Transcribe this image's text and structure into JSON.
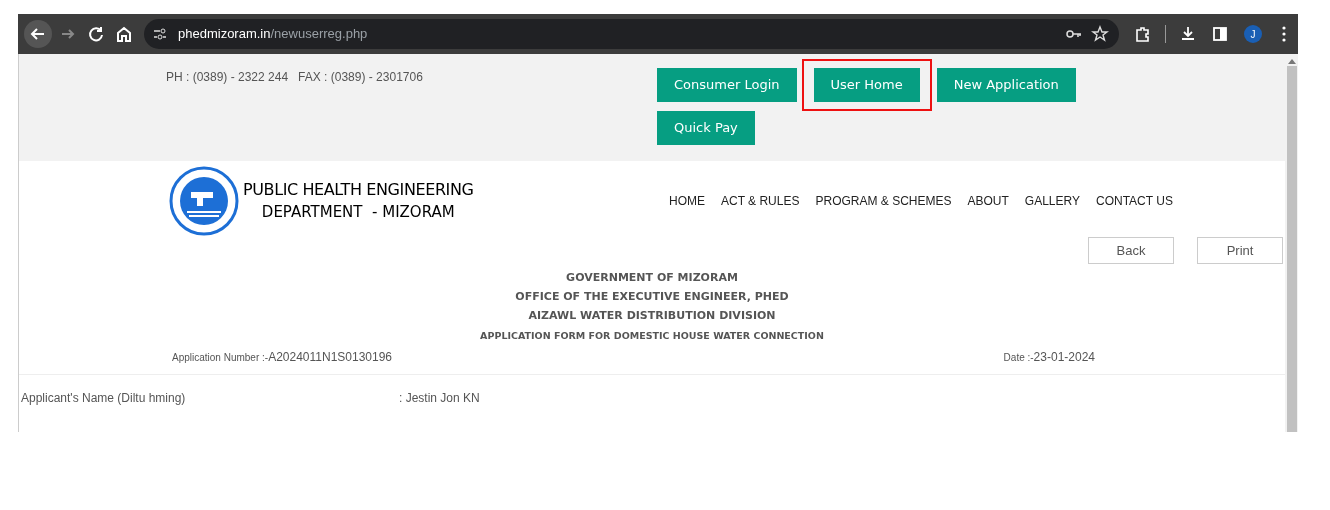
{
  "browser": {
    "url_host": "phedmizoram.in",
    "url_path": "/newuserreg.php",
    "avatar": "J"
  },
  "contact": "PH : (0389) - 2322 244   FAX : (0389) - 2301706",
  "top_buttons": [
    {
      "label": "Consumer Login",
      "highlighted": false
    },
    {
      "label": "User Home",
      "highlighted": true
    },
    {
      "label": "New Application",
      "highlighted": false
    },
    {
      "label": "Quick Pay",
      "highlighted": false
    }
  ],
  "logo": {
    "line_1": "PUBLIC HEALTH ENGINEERING",
    "line_2": "DEPARTMENT  - MIZORAM"
  },
  "nav": [
    "HOME",
    "ACT & RULES",
    "PROGRAM & SCHEMES",
    "ABOUT",
    "GALLERY",
    "CONTACT US"
  ],
  "actions": [
    "Back",
    "Print"
  ],
  "heading": [
    "GOVERNMENT OF MIZORAM",
    "OFFICE OF THE EXECUTIVE ENGINEER, PHED",
    "AIZAWL WATER DISTRIBUTION DIVISION"
  ],
  "form_title": "APPLICATION FORM FOR DOMESTIC HOUSE WATER CONNECTION",
  "application_number": {
    "label": "Application Number :-",
    "value": "A2024011N1S0130196"
  },
  "date": {
    "label": "Date :-",
    "value": "23-01-2024"
  },
  "fields": [
    {
      "label": "Applicant's Name (Diltu hming)",
      "value": ": Jestin Jon KN"
    }
  ]
}
